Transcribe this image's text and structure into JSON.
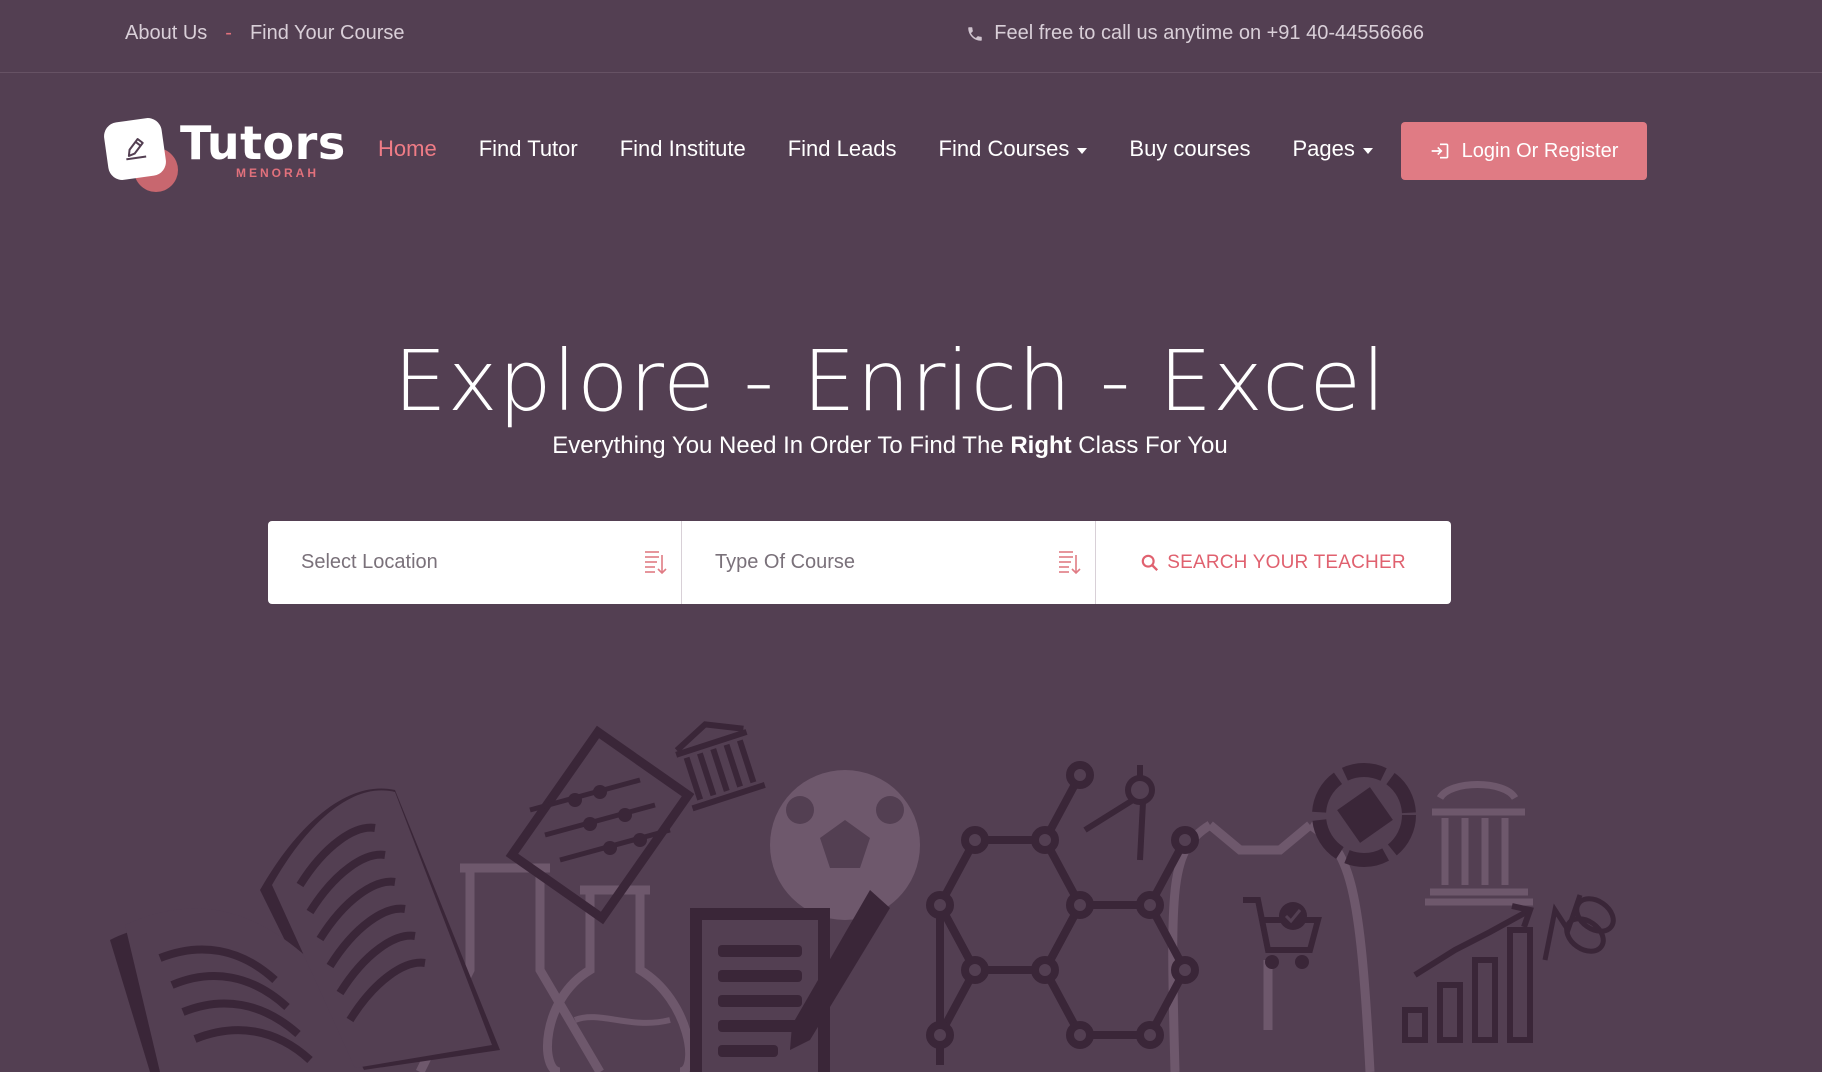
{
  "topbar": {
    "links": [
      "About Us",
      "Find Your Course"
    ],
    "separator": "-",
    "call_text": "Feel free to call us anytime on +91 40-44556666"
  },
  "logo": {
    "brand": "Tutors",
    "sub": "MENORAH"
  },
  "nav": {
    "items": [
      {
        "label": "Home",
        "active": true,
        "dropdown": false
      },
      {
        "label": "Find Tutor",
        "active": false,
        "dropdown": false
      },
      {
        "label": "Find Institute",
        "active": false,
        "dropdown": false
      },
      {
        "label": "Find Leads",
        "active": false,
        "dropdown": false
      },
      {
        "label": "Find Courses",
        "active": false,
        "dropdown": true
      },
      {
        "label": "Buy courses",
        "active": false,
        "dropdown": false
      },
      {
        "label": "Pages",
        "active": false,
        "dropdown": true
      }
    ],
    "login_label": "Login Or Register"
  },
  "hero": {
    "title": "Explore - Enrich - Excel",
    "sub_before": "Everything You Need In Order To Find The ",
    "sub_bold": "Right",
    "sub_after": " Class For You"
  },
  "search": {
    "location_placeholder": "Select Location",
    "course_placeholder": "Type Of Course",
    "button_label": "SEARCH YOUR TEACHER"
  },
  "colors": {
    "background": "#533f52",
    "accent": "#e07b84",
    "active_nav": "#ef7c86",
    "illustration_dark": "#3a2638",
    "illustration_light": "#6e586c"
  },
  "icons": [
    "phone-icon",
    "pencil-icon",
    "login-icon",
    "list-sort-icon",
    "search-icon"
  ]
}
